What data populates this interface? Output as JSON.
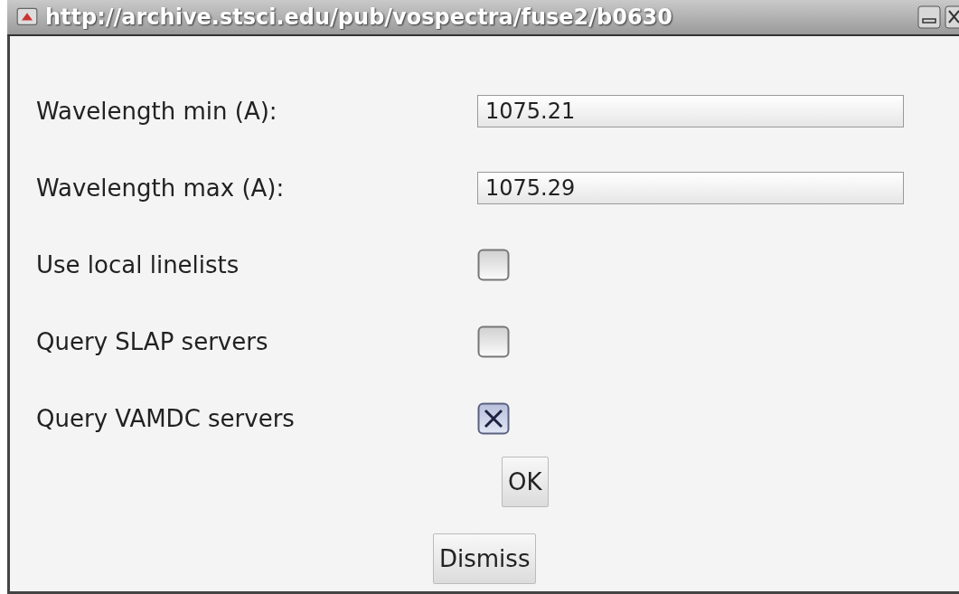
{
  "window": {
    "title": "http://archive.stsci.edu/pub/vospectra/fuse2/b0630"
  },
  "fields": [
    {
      "label": "Wavelength min (A):",
      "value": "1075.21"
    },
    {
      "label": "Wavelength max (A):",
      "value": "1075.29"
    }
  ],
  "options": [
    {
      "label": "Use local linelists",
      "checked": false
    },
    {
      "label": "Query SLAP servers",
      "checked": false
    },
    {
      "label": "Query VAMDC servers",
      "checked": true
    }
  ],
  "buttons": [
    "OK",
    "Dismiss"
  ]
}
